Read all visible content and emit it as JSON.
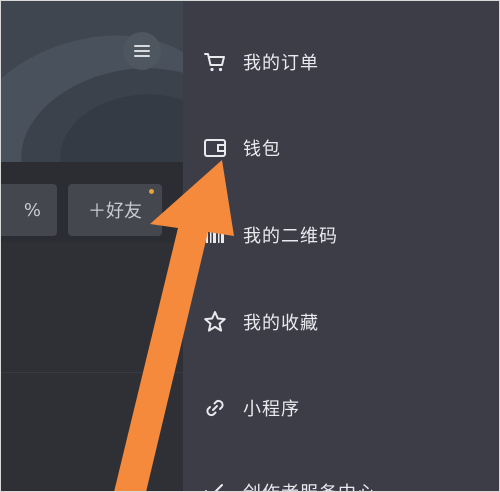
{
  "left": {
    "stat_partial": "%",
    "add_friend_label": "＋好友"
  },
  "drawer": {
    "items": [
      {
        "label": "我的订单",
        "icon": "shopping-cart-icon"
      },
      {
        "label": "钱包",
        "icon": "wallet-icon"
      },
      {
        "label": "我的二维码",
        "icon": "qr-code-icon"
      },
      {
        "label": "我的收藏",
        "icon": "star-icon"
      },
      {
        "label": "小程序",
        "icon": "link-icon"
      },
      {
        "label": "创作者服务中心",
        "icon": "creator-service-icon"
      }
    ]
  },
  "colors": {
    "drawer_bg": "#3c3d47",
    "arrow": "#f58a3c",
    "badge_dot": "#e0a43a"
  }
}
